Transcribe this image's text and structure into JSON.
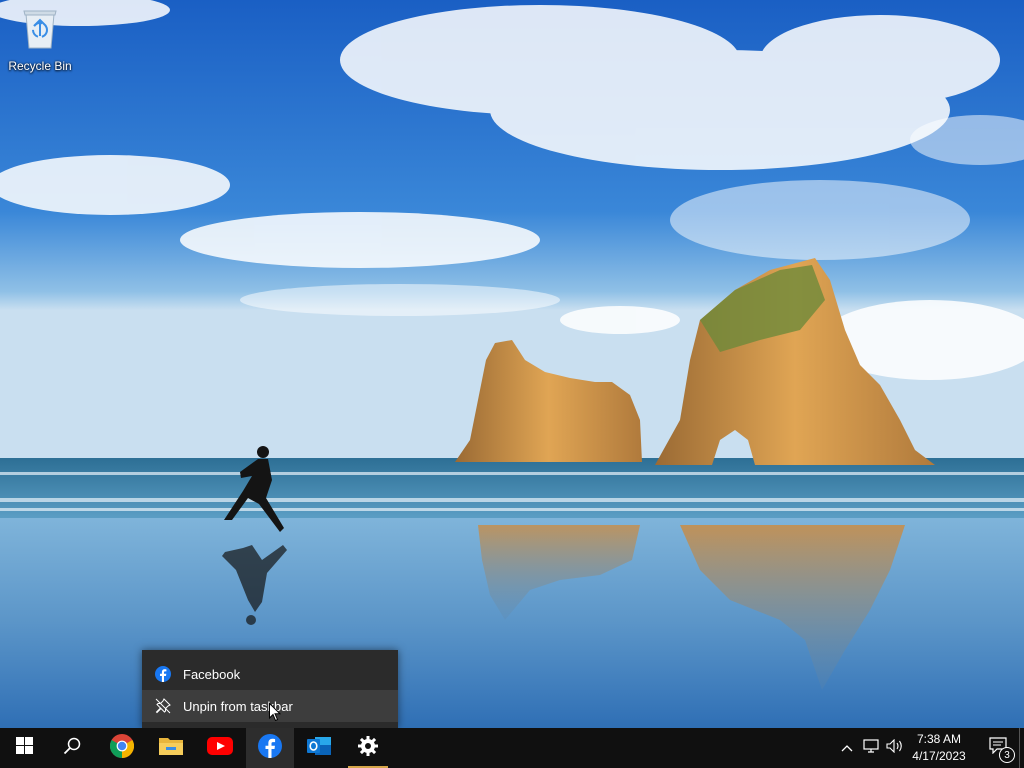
{
  "desktop": {
    "icons": [
      {
        "label": "Recycle Bin",
        "icon": "recycle-bin-icon"
      }
    ]
  },
  "jump_list": {
    "app_item": {
      "label": "Facebook",
      "icon": "facebook-icon"
    },
    "unpin_item": {
      "label": "Unpin from taskbar",
      "icon": "unpin-icon"
    }
  },
  "taskbar": {
    "pinned": [
      {
        "name": "start",
        "icon": "windows-icon"
      },
      {
        "name": "search",
        "icon": "search-icon"
      },
      {
        "name": "chrome",
        "icon": "chrome-icon"
      },
      {
        "name": "file-explorer",
        "icon": "folder-icon"
      },
      {
        "name": "youtube",
        "icon": "youtube-icon"
      },
      {
        "name": "facebook",
        "icon": "facebook-icon",
        "state": "active"
      },
      {
        "name": "outlook",
        "icon": "outlook-icon"
      },
      {
        "name": "settings",
        "icon": "gear-icon",
        "state": "running"
      }
    ],
    "tray": {
      "time": "7:38 AM",
      "date": "4/17/2023",
      "notification_count": "3"
    }
  },
  "colors": {
    "taskbar_bg": "#101010",
    "menu_bg": "#2b2b2b",
    "menu_hover": "#3d3d3d",
    "facebook_blue": "#1877f2",
    "running_indicator": "#d5a64a",
    "active_indicator": "#76b9ed"
  }
}
